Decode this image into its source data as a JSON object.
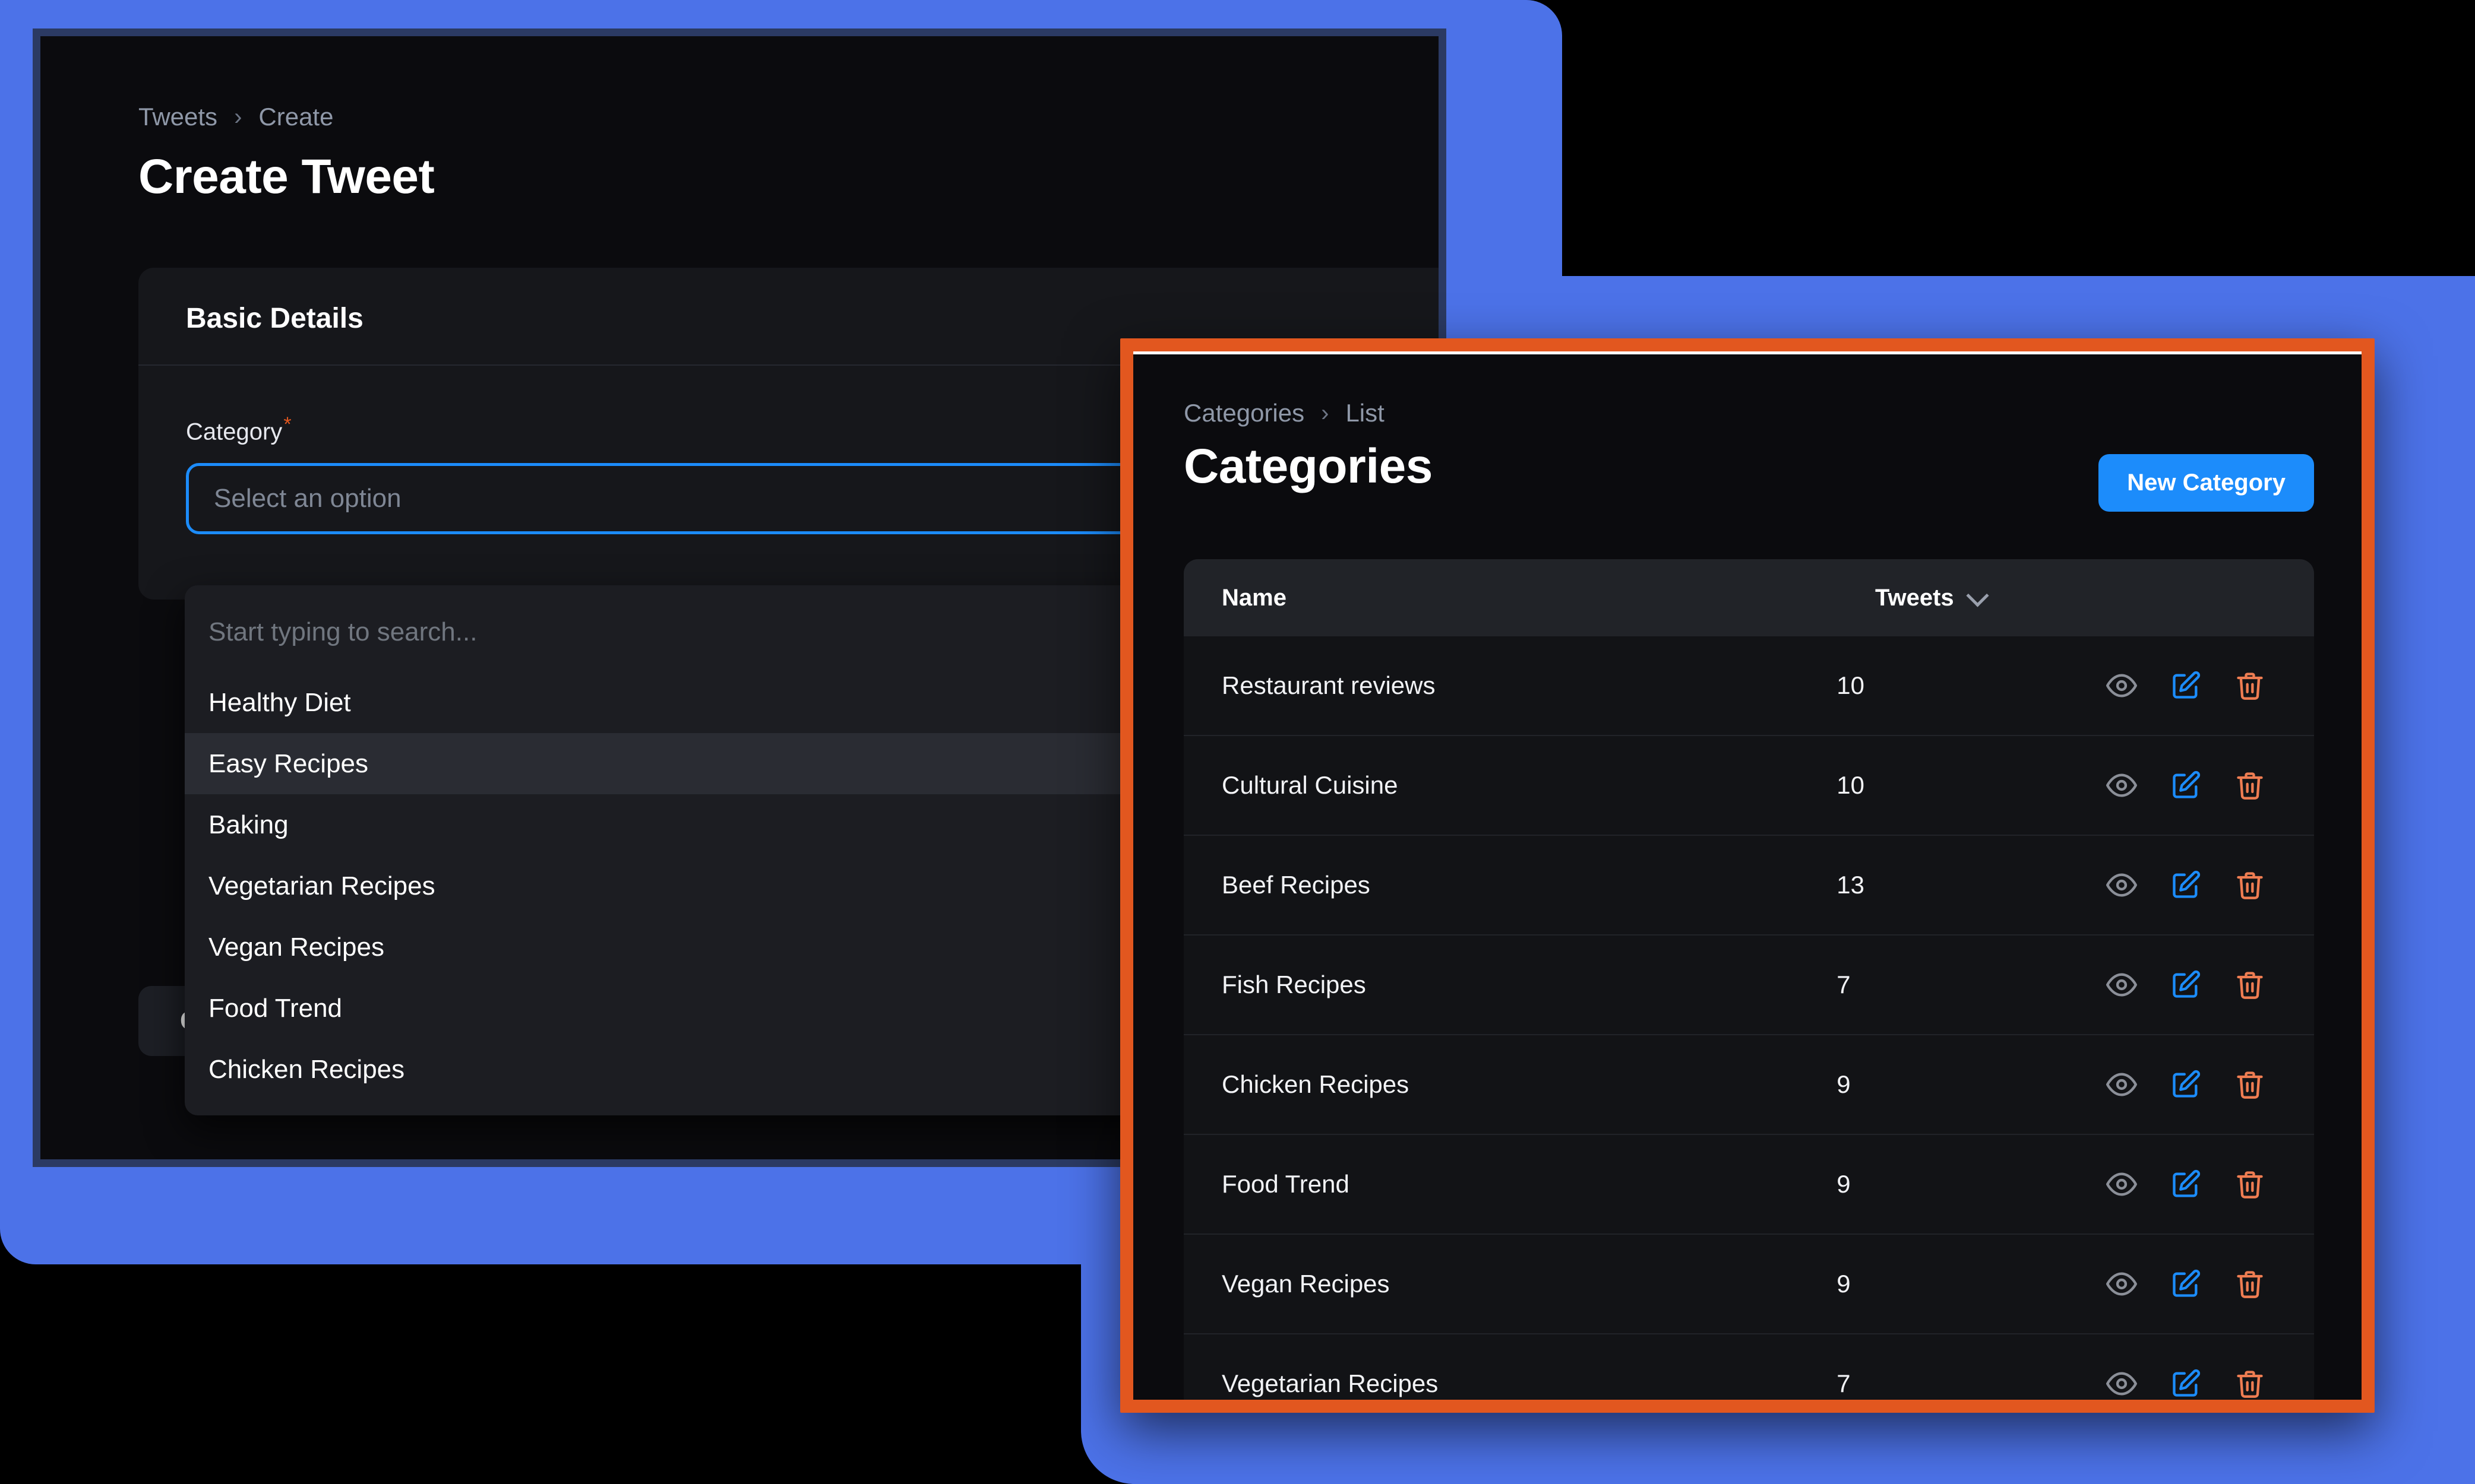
{
  "theme": {
    "backdrop_blue": "#4c72e8",
    "panel1_border": "#2b3a63",
    "panel2_border": "#e2571f",
    "accent_blue": "#1c8cfb",
    "danger_orange": "#e2571f",
    "page_bg": "#000000"
  },
  "create_tweet_panel": {
    "breadcrumb": {
      "root": "Tweets",
      "separator": "›",
      "current": "Create"
    },
    "title": "Create Tweet",
    "card": {
      "section_title": "Basic Details",
      "category_field": {
        "label": "Category",
        "required_marker": "*",
        "placeholder": "Select an option",
        "value": ""
      },
      "dropdown": {
        "search_placeholder": "Start typing to search...",
        "options": [
          {
            "label": "Healthy Diet",
            "active": false
          },
          {
            "label": "Easy Recipes",
            "active": true
          },
          {
            "label": "Baking",
            "active": false
          },
          {
            "label": "Vegetarian Recipes",
            "active": false
          },
          {
            "label": "Vegan Recipes",
            "active": false
          },
          {
            "label": "Food Trend",
            "active": false
          },
          {
            "label": "Chicken Recipes",
            "active": false
          }
        ]
      }
    },
    "footer": {
      "cancel_label": "Cancel"
    }
  },
  "categories_panel": {
    "breadcrumb": {
      "root": "Categories",
      "separator": "›",
      "current": "List"
    },
    "title": "Categories",
    "new_button_label": "New Category",
    "table": {
      "columns": [
        "Name",
        "Tweets"
      ],
      "sort_column": "Tweets",
      "sort_direction": "desc",
      "action_icons": [
        "eye-icon",
        "edit-icon",
        "trash-icon"
      ],
      "rows": [
        {
          "name": "Restaurant reviews",
          "tweets": "10"
        },
        {
          "name": "Cultural Cuisine",
          "tweets": "10"
        },
        {
          "name": "Beef Recipes",
          "tweets": "13"
        },
        {
          "name": "Fish Recipes",
          "tweets": "7"
        },
        {
          "name": "Chicken Recipes",
          "tweets": "9"
        },
        {
          "name": "Food Trend",
          "tweets": "9"
        },
        {
          "name": "Vegan Recipes",
          "tweets": "9"
        },
        {
          "name": "Vegetarian Recipes",
          "tweets": "7"
        }
      ]
    }
  }
}
